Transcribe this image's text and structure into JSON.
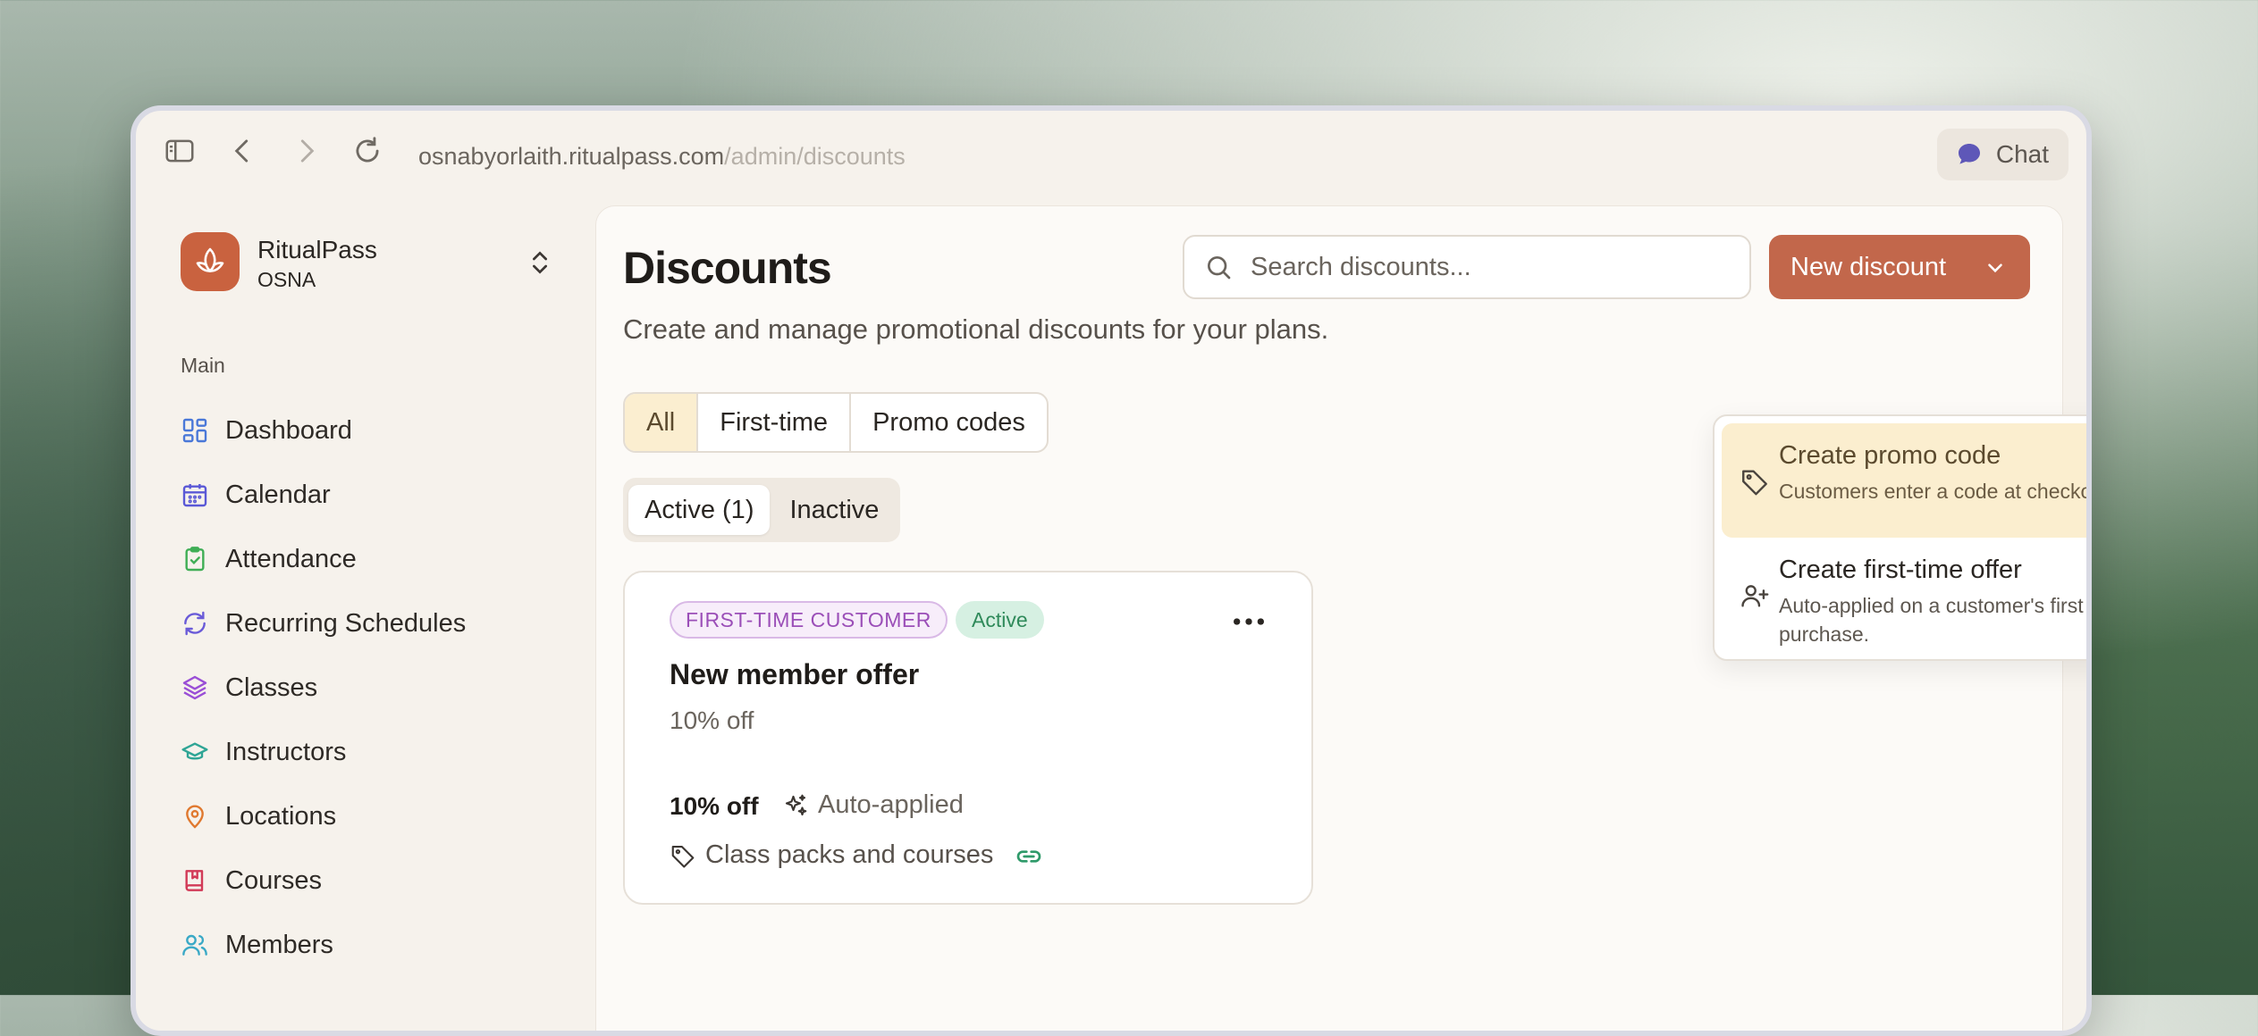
{
  "browser": {
    "url_host": "osnabyorlaith.ritualpass.com",
    "url_path": "/admin/discounts",
    "chat_label": "Chat"
  },
  "sidebar": {
    "brand_name": "RitualPass",
    "brand_sub": "OSNA",
    "section_label": "Main",
    "items": [
      {
        "label": "Dashboard",
        "icon": "dashboard-icon",
        "color": "#4a78d8"
      },
      {
        "label": "Calendar",
        "icon": "calendar-icon",
        "color": "#5a58d6"
      },
      {
        "label": "Attendance",
        "icon": "clipboard-check-icon",
        "color": "#3fae55"
      },
      {
        "label": "Recurring Schedules",
        "icon": "refresh-icon",
        "color": "#6a5bd8"
      },
      {
        "label": "Classes",
        "icon": "layers-icon",
        "color": "#9a4fd6"
      },
      {
        "label": "Instructors",
        "icon": "graduation-cap-icon",
        "color": "#2fa595"
      },
      {
        "label": "Locations",
        "icon": "map-pin-icon",
        "color": "#e0792f"
      },
      {
        "label": "Courses",
        "icon": "book-icon",
        "color": "#d23a57"
      },
      {
        "label": "Members",
        "icon": "users-icon",
        "color": "#3aa9c6"
      }
    ]
  },
  "page": {
    "title": "Discounts",
    "subtitle": "Create and manage promotional discounts for your plans.",
    "search_placeholder": "Search discounts...",
    "new_button": "New discount",
    "filters": [
      "All",
      "First-time",
      "Promo codes"
    ],
    "status_tabs": [
      "Active (1)",
      "Inactive"
    ]
  },
  "card": {
    "type_badge": "FIRST-TIME CUSTOMER",
    "status_badge": "Active",
    "title": "New member offer",
    "subtitle": "10% off",
    "amount": "10% off",
    "application": "Auto-applied",
    "scope": "Class packs and courses"
  },
  "dropdown": {
    "items": [
      {
        "title": "Create promo code",
        "desc": "Customers enter a code at checkout."
      },
      {
        "title": "Create first-time offer",
        "desc": "Auto-applied on a customer's first purchase."
      }
    ]
  },
  "colors": {
    "accent": "#c2674b",
    "brand": "#c9623f",
    "highlight": "#fbeecf"
  }
}
